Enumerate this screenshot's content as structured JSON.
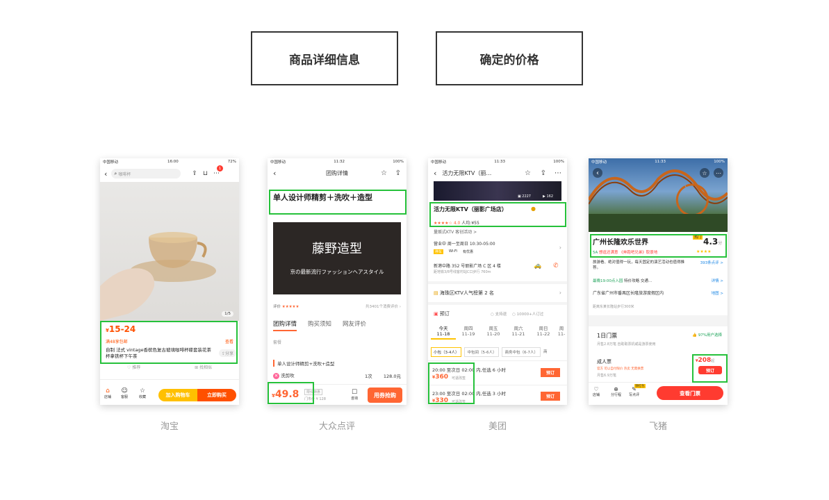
{
  "legend": {
    "product_info": "商品详细信息",
    "price": "确定的价格"
  },
  "captions": {
    "taobao": "淘宝",
    "dianping": "大众点评",
    "meituan": "美团",
    "feizhu": "飞猪"
  },
  "colors": {
    "highlight": "#25c13a",
    "taobao_orange": "#ff5000",
    "dianping_orange": "#ff6633",
    "meituan_yellow": "#ffc300",
    "feizhu_red": "#ff3b30"
  },
  "taobao": {
    "status": {
      "carrier": "中国移动",
      "time": "16:00",
      "battery": "72%"
    },
    "search_placeholder": "咖啡杯",
    "cart_badge": "1",
    "image_counter": "1/5",
    "price": "15-24",
    "currency": "¥",
    "shipping": "满48享包邮",
    "view_more": "查看",
    "title": "自制 法式 vintage香槟色复古玻璃咖啡杯碟套装花茶杯拿铁杯下午茶",
    "share": "分享",
    "recommend": "推荐",
    "find_similar": "找相似",
    "bottom": {
      "shop": "店铺",
      "service": "客服",
      "favorite": "收藏",
      "add_cart": "加入购物车",
      "buy_now": "立即购买"
    }
  },
  "dianping": {
    "status": {
      "carrier": "中国移动",
      "time": "11:32",
      "battery": "100%"
    },
    "header_title": "团购详情",
    "title": "单人设计师精剪＋洗吹＋造型",
    "shop_name": "藤野造型",
    "slogan": "京の最新流行ファッションヘアスタイル",
    "rating_label": "评价",
    "rating_stars": "★★★★★",
    "reviews": "共3401个消费评价",
    "tabs": [
      "团购详情",
      "购买须知",
      "网友评价"
    ],
    "note_label": "套餐",
    "item_title": "单人设计师精剪+洗吹+造型",
    "item_name": "洗剪吹",
    "item_qty": "1次",
    "item_price": "128.0元",
    "price": "49.8",
    "currency": "¥",
    "tag": "限价特惠",
    "orig_price": "门市价 ¥ 128",
    "consult": "咨询",
    "buy": "用券抢购"
  },
  "meituan": {
    "status": {
      "carrier": "中国移动",
      "time": "11:33",
      "battery": "100%"
    },
    "header_title": "活力无限KTV（丽…",
    "photo_count_1": "2227",
    "photo_count_2": "162",
    "shop_name": "活力无限KTV（丽影广场店）",
    "score": "4.0",
    "per_person": "人均:¥55",
    "category": "量贩式KTV",
    "extra": "客创活动 >",
    "hours": "营业中  周一至周日 10:30-05:00",
    "facilities": [
      "停车",
      "Wi-Fi",
      "有优惠"
    ],
    "address": "新港中路 352 号丽影广场 C 区 4 楼",
    "distance": "距地铁3/8号线客村站C口步行 760m",
    "ranking": "海珠区KTV人气榜第 2 名",
    "booking_label": "预订",
    "booking_tags": [
      "支持退",
      "10000+人订过"
    ],
    "dates": [
      {
        "day": "今天",
        "date": "11-18"
      },
      {
        "day": "周四",
        "date": "11-19"
      },
      {
        "day": "周五",
        "date": "11-20"
      },
      {
        "day": "周六",
        "date": "11-21"
      },
      {
        "day": "周日",
        "date": "11-22"
      },
      {
        "day": "周",
        "date": "11-"
      }
    ],
    "room_types": [
      "小包（3-4人）",
      "中包间（5-6人）",
      "商务中包（6-7人）",
      "商"
    ],
    "slots": [
      {
        "time": "20:00 至次日 02:00 内,任选 6 小时",
        "price": "360",
        "note": "可退改签",
        "book": "预订"
      },
      {
        "time": "23:00 至次日 02:00 内,任选 3 小时",
        "price": "330",
        "note": "可退改签",
        "book": "预订"
      }
    ],
    "currency": "¥"
  },
  "feizhu": {
    "status": {
      "carrier": "中国移动",
      "time": "11:33",
      "battery": "100%"
    },
    "park_name": "广州长隆欢乐世界",
    "rank_badge": "热门",
    "score": "4.3",
    "score_unit": "分",
    "level": "5A",
    "tags": "想逛还满意 《奔跑吧兄弟》取景地",
    "desc": "旅游看、绝对值得一玩，每天固定的演艺活动也值得推荐。",
    "reviews_link": "393条点评 >",
    "open_info": "最晚19:00点入园  ",
    "open_extra": "特价攻略  交通…",
    "open_link": "详情 >",
    "address": "广东省广州市番禺区长隆旅游度假区内",
    "map_link": "地图 >",
    "address_sub": "距离东某长隆站步行300米",
    "ticket_title": "1日门票",
    "recommend_tag": "97%用户选择",
    "ticket_sub": "月售2.8万笔  自助取票机或是游票使用",
    "adult": "成人票",
    "adult_tags": "官方  可以自付限价  热卖  无需换票",
    "adult_sub": "月售6.9万笔",
    "price": "208",
    "price_unit": "起",
    "currency": "¥",
    "book": "预订",
    "bottom": {
      "shop": "店铺",
      "share": "分行程",
      "comment": "写点评",
      "comment_badge": "领红包",
      "view_tickets": "查看门票"
    }
  }
}
